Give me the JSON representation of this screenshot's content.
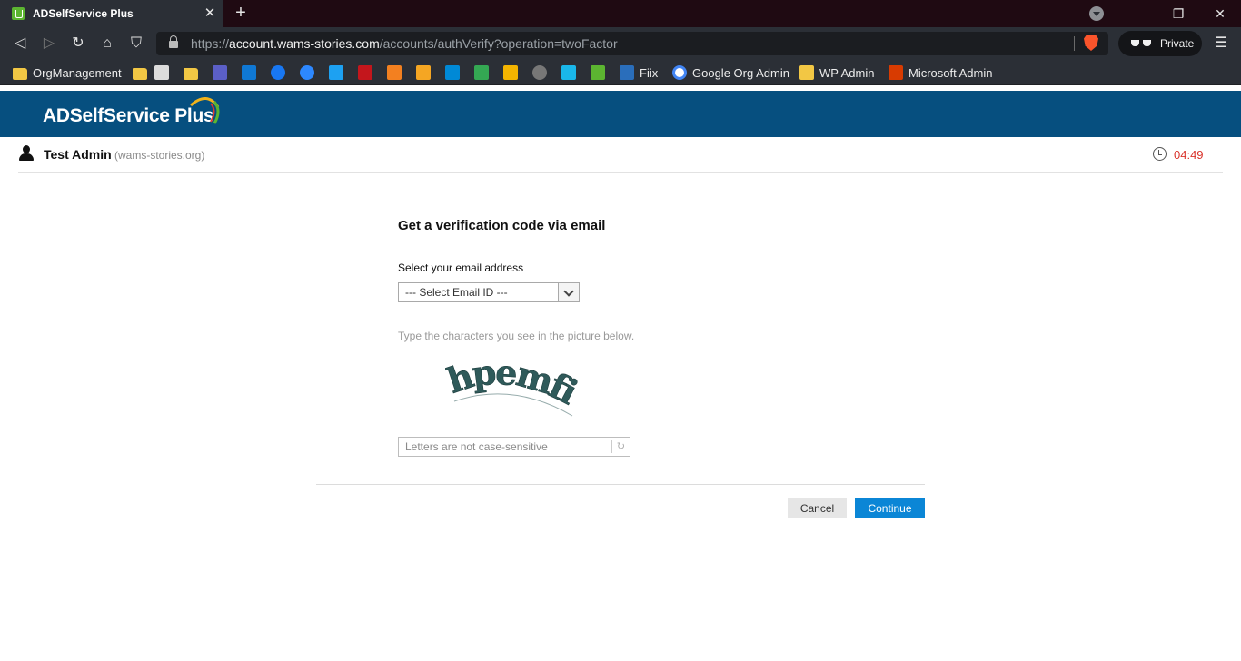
{
  "browser": {
    "tab_title": "ADSelfService Plus",
    "tab_close": "✕",
    "new_tab": "+",
    "url_scheme": "https://",
    "url_host": "account.wams-stories.com",
    "url_path": "/accounts/authVerify?operation=twoFactor",
    "private_label": "Private",
    "window_controls": {
      "minimize": "—",
      "restore": "❐",
      "close": "✕"
    },
    "nav_icons": {
      "back": "◁",
      "forward": "▷",
      "reload": "↻",
      "home": "⌂",
      "bookmark": "⛉",
      "menu": "☰"
    },
    "bookmarks": [
      {
        "label": "OrgManagement",
        "icon": "folder-icon",
        "color": "#f2c744"
      },
      {
        "label": "",
        "icon": "folder-icon",
        "color": "#f2c744"
      },
      {
        "label": "",
        "icon": "search-icon",
        "color": "#dcdcdc"
      },
      {
        "label": "",
        "icon": "folder-icon",
        "color": "#f2c744"
      },
      {
        "label": "",
        "icon": "teams-icon",
        "color": "#5b5fc7"
      },
      {
        "label": "",
        "icon": "outlook-icon",
        "color": "#0f78d4"
      },
      {
        "label": "",
        "icon": "facebook-icon",
        "color": "#1877f2"
      },
      {
        "label": "",
        "icon": "messenger-icon",
        "color": "#2d88ff"
      },
      {
        "label": "",
        "icon": "twitter-icon",
        "color": "#1da1f2"
      },
      {
        "label": "",
        "icon": "j-icon",
        "color": "#c4161c"
      },
      {
        "label": "",
        "icon": "cloud-icon",
        "color": "#f38020"
      },
      {
        "label": "",
        "icon": "people-icon",
        "color": "#f5a623"
      },
      {
        "label": "",
        "icon": "azure-icon",
        "color": "#0089d6"
      },
      {
        "label": "",
        "icon": "drive-icon",
        "color": "#34a853"
      },
      {
        "label": "",
        "icon": "slides-icon",
        "color": "#f4b400"
      },
      {
        "label": "",
        "icon": "hex-icon",
        "color": "#777777"
      },
      {
        "label": "",
        "icon": "vimeo-icon",
        "color": "#1ab7ea"
      },
      {
        "label": "",
        "icon": "adself-icon",
        "color": "#5cb531"
      },
      {
        "label": "Fiix",
        "icon": "fiix-icon",
        "color": "#2a6ebb"
      },
      {
        "label": "Google Org Admin",
        "icon": "google-icon",
        "color": "#ffffff"
      },
      {
        "label": "WP Admin",
        "icon": "shield-icon",
        "color": "#f2c744"
      },
      {
        "label": "Microsoft Admin",
        "icon": "office-icon",
        "color": "#d83b01"
      }
    ]
  },
  "app": {
    "logo_text": "ADSelfService Plus",
    "user_name": "Test Admin",
    "user_domain": "(wams-stories.org)",
    "timer": "04:49",
    "accent": "#064f7f"
  },
  "form": {
    "title": "Get a verification code via email",
    "email_label": "Select your email address",
    "email_select_value": "--- Select Email ID ---",
    "captcha_label": "Type the characters you see in the picture below.",
    "captcha_text": "hpemfi",
    "captcha_placeholder": "Letters are not case-sensitive",
    "refresh_glyph": "↻",
    "cancel_label": "Cancel",
    "continue_label": "Continue",
    "continue_color": "#0b86d6"
  }
}
